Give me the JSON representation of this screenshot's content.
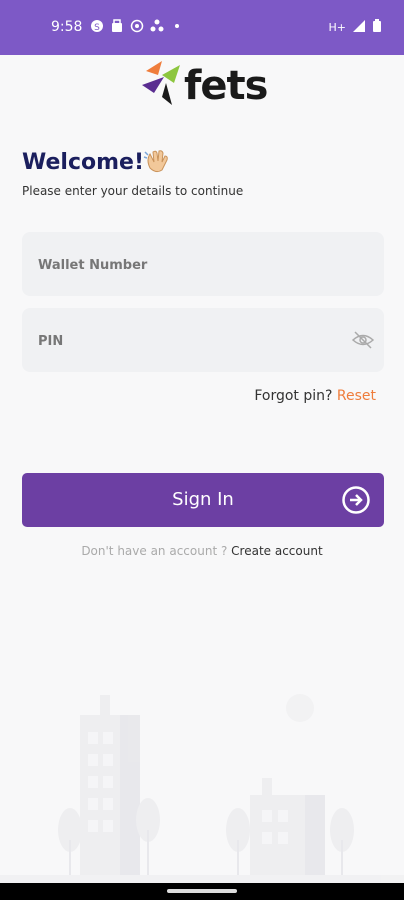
{
  "status_bar": {
    "time": "9:58",
    "network": "H+"
  },
  "brand": {
    "name": "fets"
  },
  "welcome": {
    "title": "Welcome!",
    "subtitle": "Please enter your details to continue"
  },
  "form": {
    "wallet_placeholder": "Wallet Number",
    "pin_placeholder": "PIN",
    "forgot_text": "Forgot pin?",
    "reset_label": "Reset",
    "signin_label": "Sign In",
    "no_account_text": "Don't have an account ?",
    "create_account_label": "Create account"
  },
  "colors": {
    "status_bar": "#7d59c6",
    "primary_button": "#6c3fa3",
    "title": "#1b1f5e",
    "reset_link": "#ef7d3c"
  },
  "icons": [
    "skype-icon",
    "bag-icon",
    "whatsapp-icon",
    "fan-icon",
    "dot-icon",
    "signal-icon",
    "battery-icon",
    "wave-hand-icon",
    "eye-off-icon",
    "arrow-right-circle-icon"
  ]
}
